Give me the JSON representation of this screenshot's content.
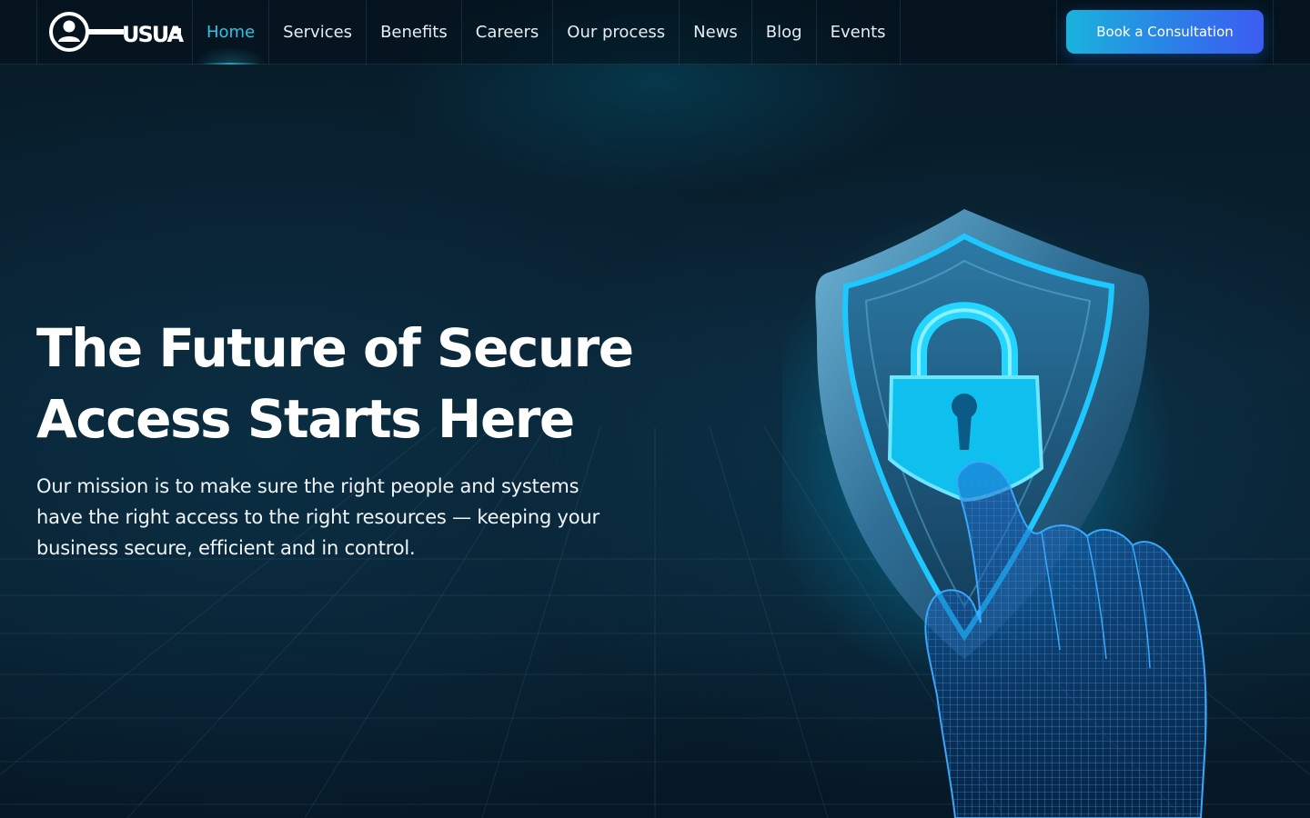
{
  "brand": {
    "logo_text": "USUA"
  },
  "nav": {
    "items": [
      {
        "label": "Home",
        "active": true
      },
      {
        "label": "Services",
        "active": false
      },
      {
        "label": "Benefits",
        "active": false
      },
      {
        "label": "Careers",
        "active": false
      },
      {
        "label": "Our process",
        "active": false
      },
      {
        "label": "News",
        "active": false
      },
      {
        "label": "Blog",
        "active": false
      },
      {
        "label": "Events",
        "active": false
      }
    ],
    "cta_label": "Book a Consultation"
  },
  "hero": {
    "title_line1": "The Future of Secure",
    "title_line2": "Access Starts Here",
    "subtitle": "Our mission is to make sure the right people and systems have the right access to the right resources — keeping your business secure, efficient and in control.",
    "illustration": "shield-lock-hand-icon"
  },
  "colors": {
    "background": "#06141f",
    "accent": "#2fc4e6",
    "cta_start": "#1ab3dc",
    "cta_end": "#3d5cf2"
  }
}
